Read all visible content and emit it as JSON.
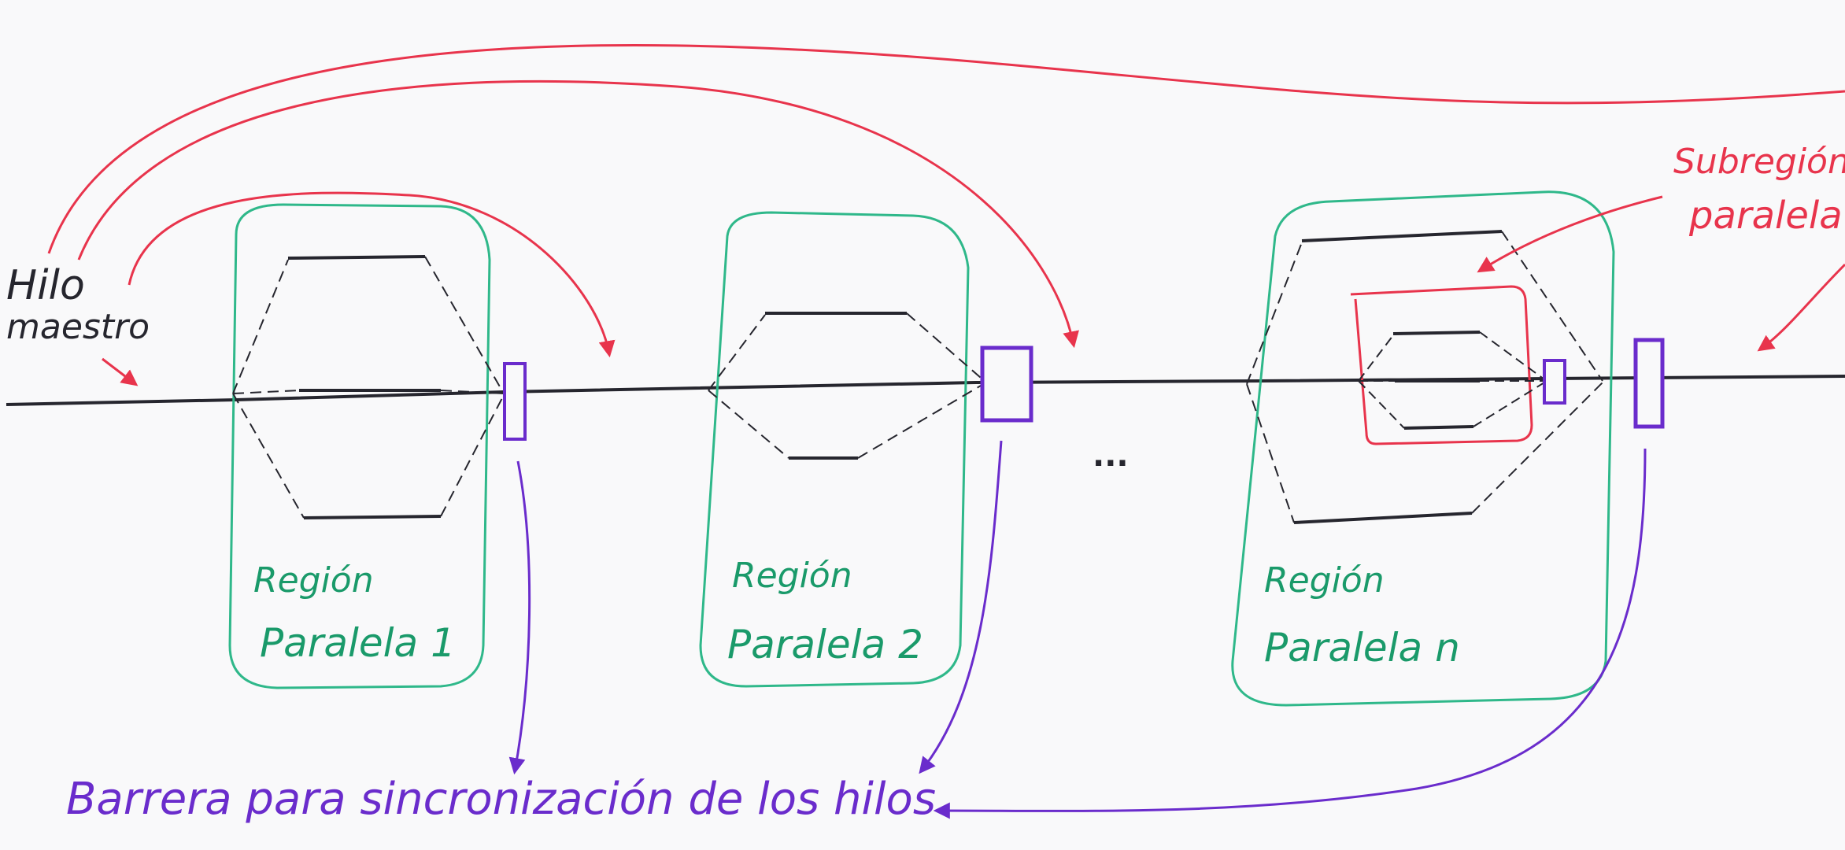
{
  "labels": {
    "master_thread_line1": "Hilo",
    "master_thread_line2": "maestro",
    "subregion_line1": "Subregión",
    "subregion_line2": "paralela",
    "region1_line1": "Región",
    "region1_line2": "Paralela 1",
    "region2_line1": "Región",
    "region2_line2": "Paralela 2",
    "regionn_line1": "Región",
    "regionn_line2": "Paralela n",
    "ellipsis": "...",
    "barrier": "Barrera para sincronización de los hilos"
  },
  "colors": {
    "thread": "#26262e",
    "region_outline": "#2fb88a",
    "region_text": "#1a9a6a",
    "fork_arrows": "#e8344c",
    "barrier": "#6a2ccc",
    "paper": "#f9f9fa"
  }
}
